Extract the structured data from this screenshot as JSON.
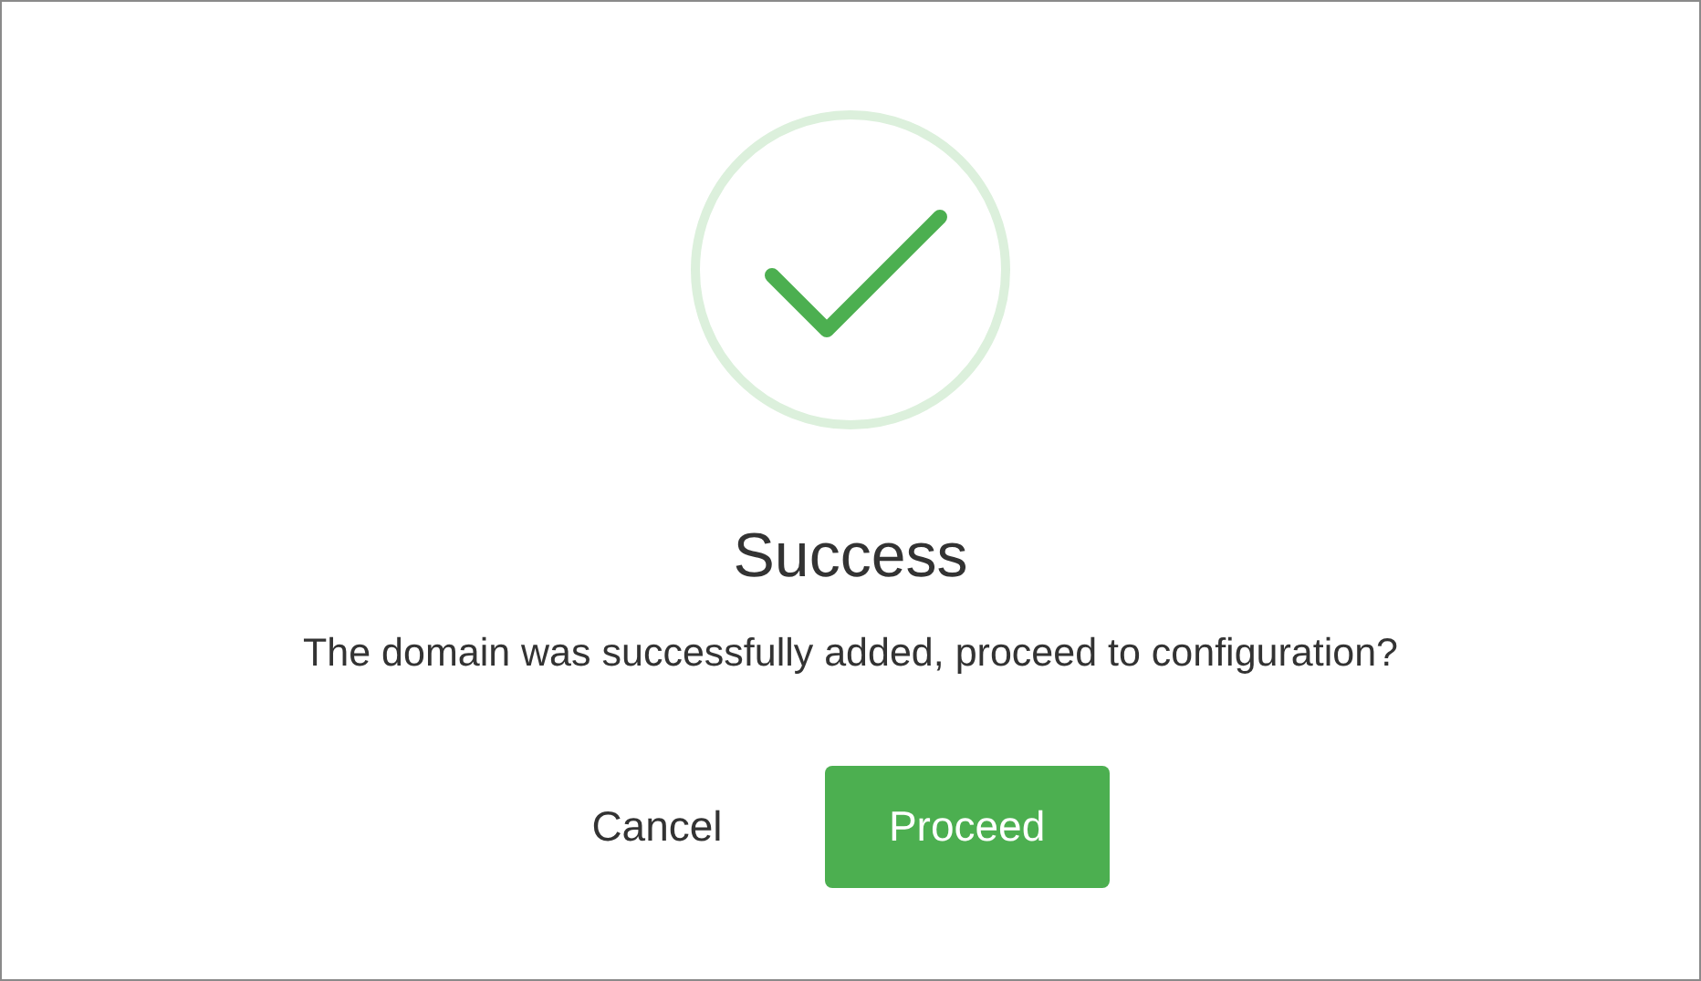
{
  "dialog": {
    "succeeded": true,
    "title": "Success",
    "message": "The domain was successfully added, proceed to configuration?",
    "buttons": [
      {
        "label": "Cancel",
        "kind": "text"
      },
      {
        "label": "Proceed",
        "kind": "primary"
      }
    ]
  }
}
